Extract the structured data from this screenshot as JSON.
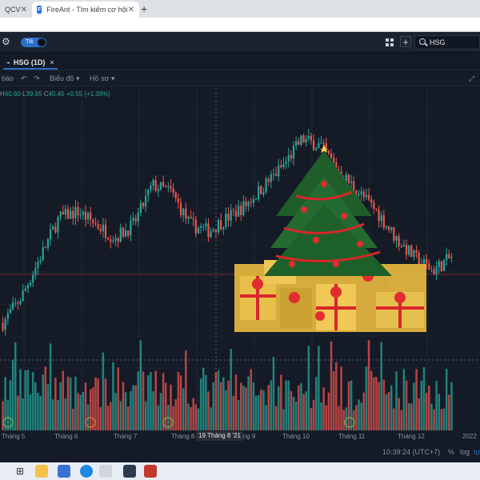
{
  "browser": {
    "tabs": [
      {
        "label": "QCV"
      },
      {
        "label": "FireAnt - Tìm kiếm cơ hội",
        "favicon": "F"
      }
    ],
    "new_tab": "+"
  },
  "toolbar": {
    "theme_label": "Tối",
    "search_value": "HSG"
  },
  "chart_tab": {
    "label": "HSG (1D)",
    "close": "×"
  },
  "chart_toolbar": {
    "items": [
      "báo",
      "↶",
      "↷",
      "Biểu đồ ▾",
      "Hồ sơ ▾"
    ]
  },
  "ohlc": {
    "h_label": "H",
    "h": "40.60",
    "l_label": "L",
    "l": "39.95",
    "c_label": "C",
    "c": "40.45",
    "change": "+0.55 (+1.38%)"
  },
  "chart_data": {
    "type": "candlestick",
    "x_ticks": [
      "Tháng 5",
      "Tháng 6",
      "Tháng 7",
      "Tháng 8",
      "Tháng 9",
      "Tháng 10",
      "Tháng 11",
      "Tháng 12",
      "2022"
    ],
    "crosshair_date": "19 Tháng 8 '21",
    "colors": {
      "up": "#26a69a",
      "down": "#ef5350",
      "grid": "#1f2633",
      "price_line": "#7a2a2f"
    },
    "trend": [
      30,
      34,
      40,
      46,
      47,
      45,
      43,
      45,
      51,
      50,
      45,
      44,
      46,
      48,
      51,
      54,
      58,
      57,
      53,
      50,
      47,
      43,
      40,
      38,
      40
    ]
  },
  "status": {
    "time": "10:39:24 (UTC+7)",
    "percent": "%",
    "log": "log",
    "auto": "tự"
  }
}
